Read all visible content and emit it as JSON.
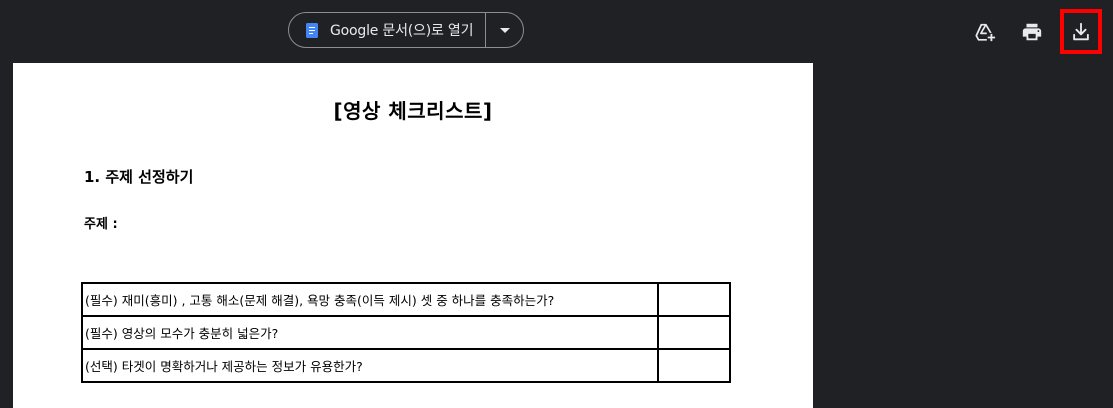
{
  "toolbar": {
    "open_with_label": "Google 문서(으)로 열기",
    "icons": [
      "docs-icon",
      "dropdown-caret-icon",
      "add-to-drive-icon",
      "print-icon",
      "download-icon"
    ]
  },
  "document": {
    "title": "[영상 체크리스트]",
    "section_heading": "1. 주제 선정하기",
    "topic_label": "주제 :",
    "checklist": [
      {
        "question": "(필수) 재미(흥미) , 고통 해소(문제 해결), 욕망 충족(이득 제시) 셋 중 하나를 충족하는가?",
        "check": ""
      },
      {
        "question": "(필수) 영상의 모수가 충분히 넓은가?",
        "check": ""
      },
      {
        "question": "(선택) 타겟이 명확하거나 제공하는 정보가 유용한가?",
        "check": ""
      }
    ]
  },
  "colors": {
    "viewer_background": "#202124",
    "docs_blue": "#4285f4",
    "highlight_red": "#ff0000"
  }
}
